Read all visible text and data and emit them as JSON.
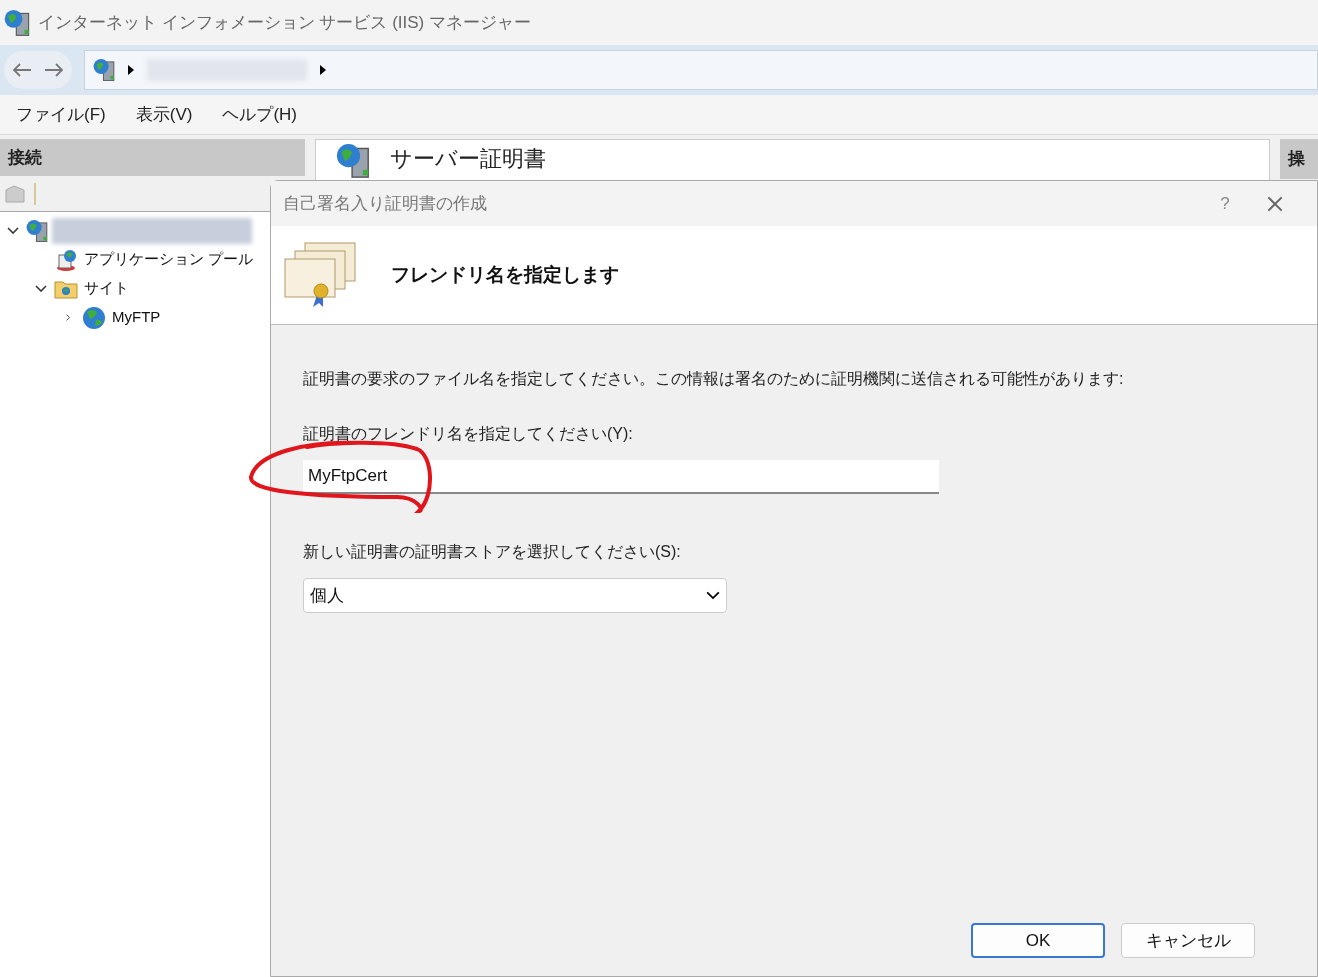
{
  "window": {
    "title": "インターネット インフォメーション サービス (IIS) マネージャー"
  },
  "menu": [
    {
      "label": "ファイル(F)"
    },
    {
      "label": "表示(V)"
    },
    {
      "label": "ヘルプ(H)"
    }
  ],
  "connections": {
    "title": "接続",
    "tree": [
      {
        "kind": "server",
        "expanded": true,
        "selected": true,
        "children": [
          {
            "label": "アプリケーション プール",
            "kind": "pool"
          },
          {
            "label": "サイト",
            "kind": "folder",
            "expanded": true,
            "selected": false,
            "children": [
              {
                "label": "MyFTP",
                "kind": "globe",
                "expanded": false,
                "selected": false
              }
            ]
          }
        ]
      }
    ]
  },
  "content": {
    "title": "サーバー証明書"
  },
  "actions": {
    "title": "操"
  },
  "dialog": {
    "title": "自己署名入り証明書の作成",
    "help": "?",
    "heading": "フレンドリ名を指定します",
    "description": "証明書の要求のファイル名を指定してください。この情報は署名のために証明機関に送信される可能性があります:",
    "name_label": "証明書のフレンドリ名を指定してください(Y):",
    "name_value": "MyFtpCert",
    "store_label": "新しい証明書の証明書ストアを選択してください(S):",
    "store_value": "個人",
    "buttons": [
      {
        "label": "OK",
        "default": true
      },
      {
        "label": "キャンセル",
        "default": false
      }
    ]
  }
}
